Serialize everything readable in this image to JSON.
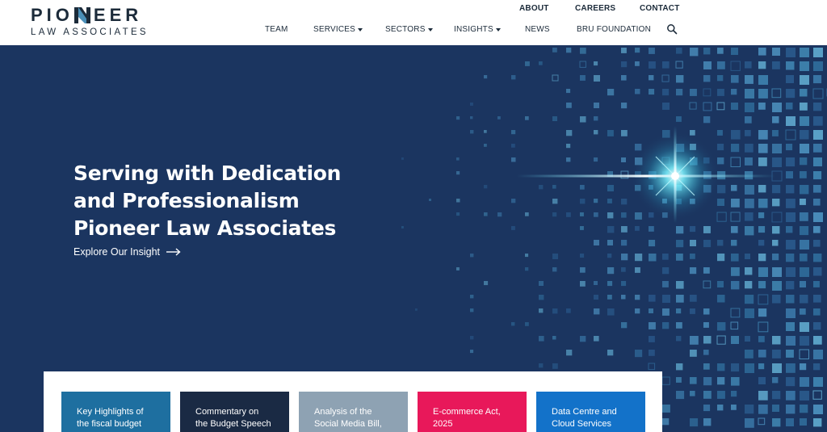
{
  "brand": {
    "name_part1": "PIO",
    "name_part2": "EER",
    "tagline": "LAW ASSOCIATES",
    "mark_colors": {
      "dark": "#1c2b3a",
      "accent": "#4a8fb8"
    }
  },
  "top_nav": {
    "about": "ABOUT",
    "careers": "CAREERS",
    "contact": "CONTACT"
  },
  "main_nav": {
    "items": [
      {
        "label": "TEAM",
        "has_dropdown": false
      },
      {
        "label": "SERVICES",
        "has_dropdown": true
      },
      {
        "label": "SECTORS",
        "has_dropdown": true
      },
      {
        "label": "INSIGHTS",
        "has_dropdown": true
      },
      {
        "label": "NEWS",
        "has_dropdown": false
      },
      {
        "label": "BRU FOUNDATION",
        "has_dropdown": false
      }
    ],
    "search_icon": "search-icon"
  },
  "hero": {
    "title_lines": [
      "Serving with Dedication",
      "and Professionalism",
      "Pioneer Law Associates"
    ],
    "cta_label": "Explore Our Insight",
    "cta_icon": "arrow-right-icon",
    "background_color": "#1b3560"
  },
  "cards": [
    {
      "lines": [
        "Key Highlights of",
        "the fiscal budget"
      ],
      "color": "#1e6fa0"
    },
    {
      "lines": [
        "Commentary on",
        "the Budget Speech"
      ],
      "color": "#1a2a44"
    },
    {
      "lines": [
        "Analysis of the",
        "Social Media Bill,"
      ],
      "color": "#8ea2b3"
    },
    {
      "lines": [
        "E-commerce Act,",
        "2025"
      ],
      "color": "#e8185a"
    },
    {
      "lines": [
        "Data Centre and",
        "Cloud Services"
      ],
      "color": "#1372c9"
    }
  ]
}
